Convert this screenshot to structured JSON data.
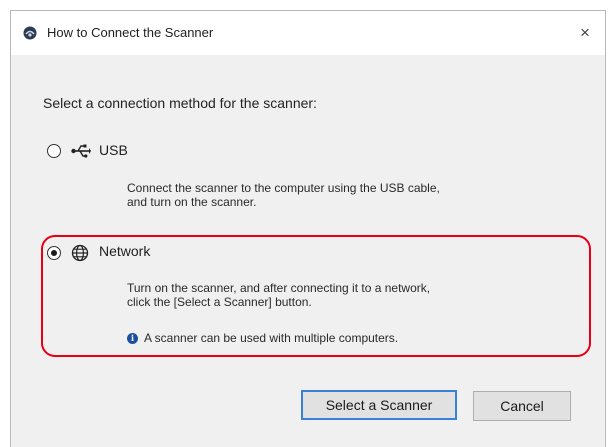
{
  "window": {
    "title": "How to Connect the Scanner",
    "close_glyph": "×",
    "app_icon": "scanner-app-icon"
  },
  "prompt": "Select a connection method for the scanner:",
  "options": [
    {
      "id": "usb",
      "label": "USB",
      "icon": "usb-icon",
      "selected": false,
      "description": [
        "Connect the scanner to the computer using the USB cable,",
        "and turn on the scanner."
      ]
    },
    {
      "id": "network",
      "label": "Network",
      "icon": "network-globe-icon",
      "selected": true,
      "description": [
        "Turn on the scanner, and after connecting it to a network,",
        "click the [Select a Scanner] button."
      ],
      "info_icon": "info-icon",
      "info": "A scanner can be used with multiple computers."
    }
  ],
  "buttons": {
    "select_scanner": "Select a Scanner",
    "cancel": "Cancel"
  },
  "colors": {
    "highlight": "#e60012",
    "info_icon": "#1b4f9c",
    "default_button_border": "#3b7fd6"
  }
}
